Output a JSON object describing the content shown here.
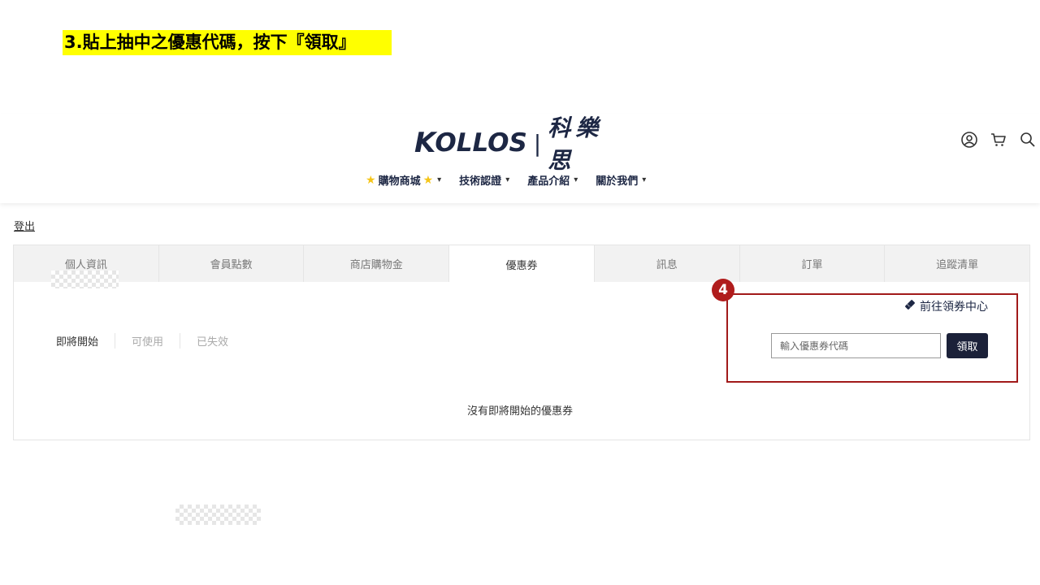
{
  "instruction": "3.貼上抽中之優惠代碼，按下『領取』",
  "logo": {
    "k": "K",
    "wordmark": "OLLOS",
    "separator": "|",
    "chinese": "科樂思"
  },
  "nav": [
    {
      "label": "購物商城"
    },
    {
      "label": "技術認證"
    },
    {
      "label": "產品介紹"
    },
    {
      "label": "關於我們"
    }
  ],
  "logout": "登出",
  "tabs": [
    "個人資訊",
    "會員點數",
    "商店購物金",
    "優惠券",
    "訊息",
    "訂單",
    "追蹤清單"
  ],
  "active_tab": "優惠券",
  "filters": [
    "即將開始",
    "可使用",
    "已失效"
  ],
  "active_filter": "即將開始",
  "empty_message": "沒有即將開始的優惠券",
  "step_badge": "4",
  "goto_center": "前往領券中心",
  "coupon_input": {
    "placeholder": "輸入優惠券代碼",
    "value": ""
  },
  "claim_button": "領取",
  "colors": {
    "navy": "#1d2744",
    "highlight": "#ffff00",
    "annotation_red": "#a11a1a",
    "star": "#f5c518"
  },
  "icons": [
    "user-icon",
    "cart-icon",
    "search-icon",
    "star-icon",
    "chevron-down-icon",
    "ticket-icon"
  ]
}
